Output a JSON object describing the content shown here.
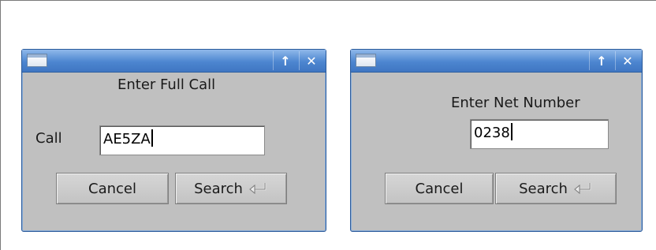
{
  "left_dialog": {
    "prompt": "Enter Full Call",
    "field_label": "Call",
    "field_value": "AE5ZA",
    "cancel_label": "Cancel",
    "search_label": "Search"
  },
  "right_dialog": {
    "prompt": "Enter Net Number",
    "field_value": "0238",
    "cancel_label": "Cancel",
    "search_label": "Search"
  },
  "titlebar": {
    "maximize_glyph": "↑",
    "close_glyph": "✕"
  },
  "colors": {
    "titlebar": "#4d86d0",
    "dialog_bg": "#c0c0c0"
  }
}
